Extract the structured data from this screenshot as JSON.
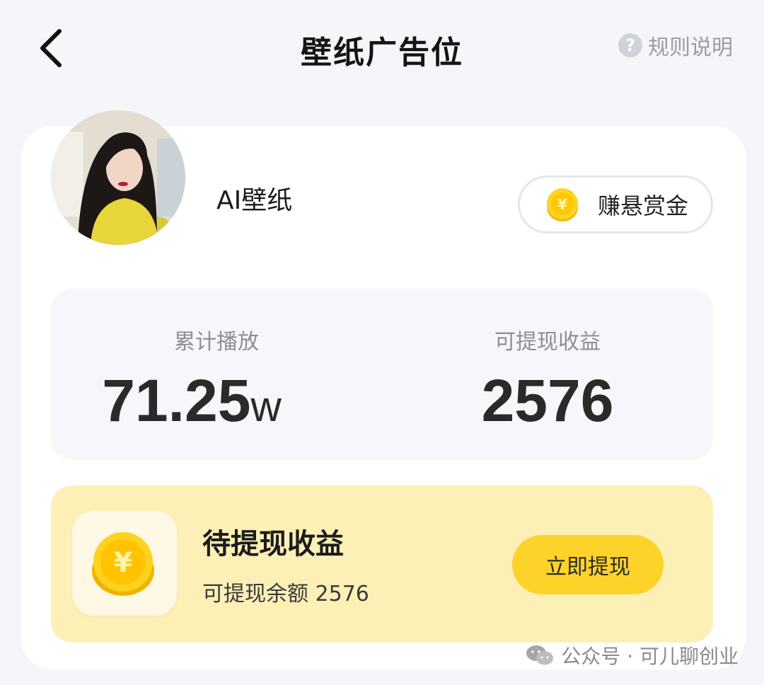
{
  "header": {
    "title": "壁纸广告位",
    "rules_label": "规则说明",
    "rules_icon_glyph": "?"
  },
  "profile": {
    "username": "AI壁纸",
    "bounty_label": "赚悬赏金",
    "coin_symbol": "¥"
  },
  "stats": {
    "plays_label": "累计播放",
    "plays_value": "71.25",
    "plays_unit": "w",
    "earnings_label": "可提现收益",
    "earnings_value": "2576"
  },
  "pending": {
    "title": "待提现收益",
    "balance_text": "可提现余额 2576",
    "withdraw_label": "立即提现"
  },
  "watermark": {
    "text": "公众号 · 可儿聊创业"
  },
  "colors": {
    "accent_yellow": "#fdd32a",
    "pending_bg": "#fdf0b6",
    "page_bg": "#f4f6fa"
  }
}
